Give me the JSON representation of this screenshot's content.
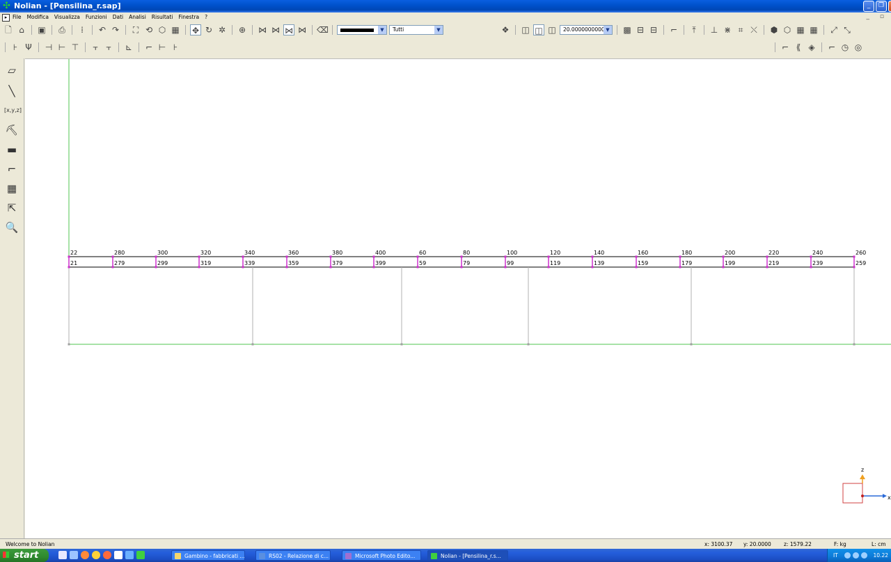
{
  "window": {
    "title": "Nolian - [Pensilina_r.sap]",
    "app_icon": "nolian-icon",
    "controls": [
      "minimize-icon",
      "restore-icon",
      "close-icon"
    ]
  },
  "menubar": {
    "items": [
      "File",
      "Modifica",
      "Visualizza",
      "Funzioni",
      "Dati",
      "Analisi",
      "Risultati",
      "Finestra",
      "?"
    ]
  },
  "toolbar": {
    "line_color": "#000000",
    "layer_select": "Tutti",
    "size_value": "20.0000000000"
  },
  "model": {
    "top_labels": [
      "22",
      "280",
      "300",
      "320",
      "340",
      "360",
      "380",
      "400",
      "60",
      "80",
      "100",
      "120",
      "140",
      "160",
      "180",
      "200",
      "220",
      "240",
      "260"
    ],
    "bottom_labels": [
      "21",
      "279",
      "299",
      "319",
      "339",
      "359",
      "379",
      "399",
      "59",
      "79",
      "99",
      "119",
      "139",
      "159",
      "179",
      "199",
      "219",
      "239",
      "259"
    ],
    "axis_labels": {
      "z": "z",
      "x": "x"
    }
  },
  "statusbar": {
    "message": "Welcome to Nolian",
    "x": "x: 3100.37",
    "y": "y: 20.0000",
    "z": "z: 1579.22",
    "force_unit": "F: kg",
    "length_unit": "L: cm"
  },
  "taskbar": {
    "start_label": "start",
    "tasks": [
      "Gambino - fabbricati ...",
      "RS02 - Relazione di c...",
      "Microsoft Photo Edito...",
      "Nolian - [Pensilina_r.s..."
    ],
    "lang": "IT",
    "clock": "10.22"
  }
}
